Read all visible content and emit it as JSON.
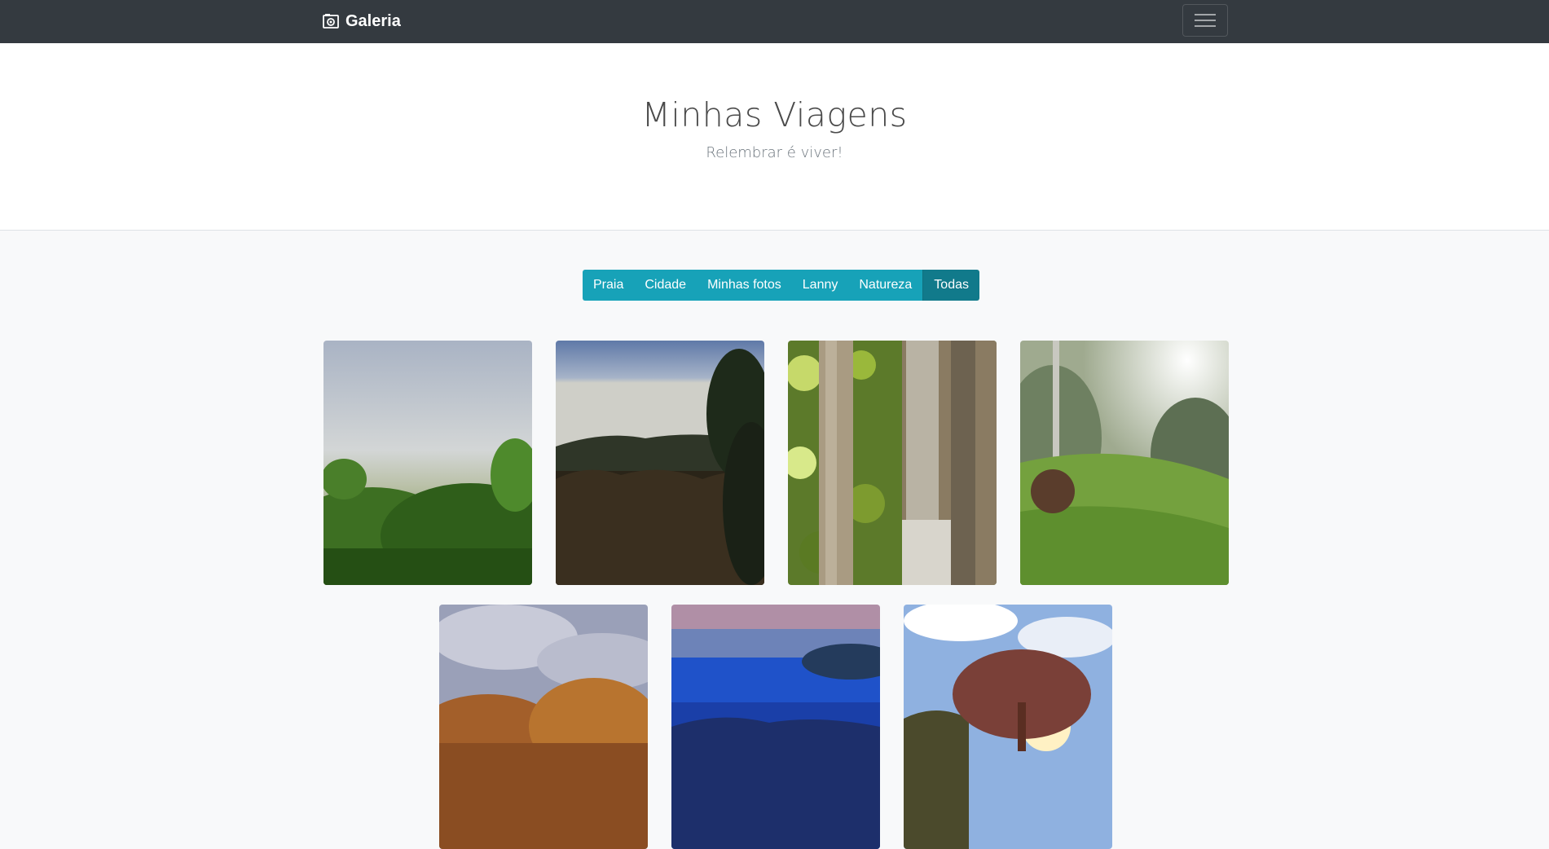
{
  "navbar": {
    "brand_label": "Galeria",
    "brand_icon": "camera-icon",
    "toggler_icon": "hamburger-menu-icon"
  },
  "hero": {
    "title": "Minhas Viagens",
    "subtitle": "Relembrar é viver!"
  },
  "filters": {
    "items": [
      {
        "label": "Praia",
        "active": false
      },
      {
        "label": "Cidade",
        "active": false
      },
      {
        "label": "Minhas fotos",
        "active": false
      },
      {
        "label": "Lanny",
        "active": false
      },
      {
        "label": "Natureza",
        "active": false
      },
      {
        "label": "Todas",
        "active": true
      }
    ]
  },
  "gallery": {
    "photos": [
      {
        "subject": "foggy-forest-hillside"
      },
      {
        "subject": "mountain-silhouette-dusk"
      },
      {
        "subject": "tree-trunks-closeup"
      },
      {
        "subject": "misty-grass-clearing"
      },
      {
        "subject": "treetops-cloudy-sky"
      },
      {
        "subject": "blue-lake-reflection"
      },
      {
        "subject": "tree-at-sunset"
      }
    ]
  },
  "colors": {
    "navbar_bg": "#343a40",
    "filter_bg": "#17a2b8",
    "filter_active_bg": "#117a8b",
    "page_bg": "#f8f9fa"
  }
}
